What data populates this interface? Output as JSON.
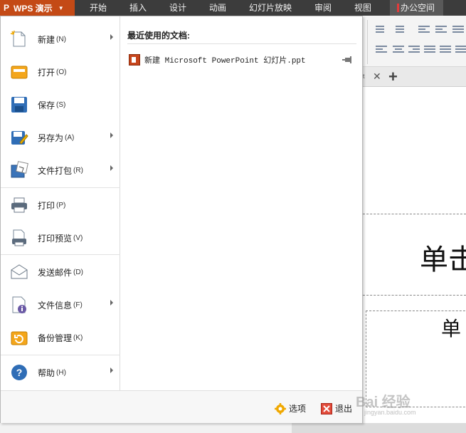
{
  "app": {
    "logo": "P",
    "title": "WPS 演示"
  },
  "menubar": {
    "tabs": [
      "开始",
      "插入",
      "设计",
      "动画",
      "幻灯片放映",
      "审阅",
      "视图"
    ],
    "office": "办公空间"
  },
  "file_menu": {
    "items": [
      {
        "label": "新建",
        "key": "(N)",
        "icon": "new-file-icon",
        "submenu": true
      },
      {
        "label": "打开",
        "key": "(O)",
        "icon": "open-folder-icon",
        "submenu": false
      },
      {
        "label": "保存",
        "key": "(S)",
        "icon": "save-disk-icon",
        "submenu": false
      },
      {
        "label": "另存为",
        "key": "(A)",
        "icon": "save-as-icon",
        "submenu": true
      },
      {
        "label": "文件打包",
        "key": "(R)",
        "icon": "package-icon",
        "submenu": true
      },
      {
        "label": "打印",
        "key": "(P)",
        "icon": "printer-icon",
        "submenu": false
      },
      {
        "label": "打印预览",
        "key": "(V)",
        "icon": "print-preview-icon",
        "submenu": false
      },
      {
        "label": "发送邮件",
        "key": "(D)",
        "icon": "mail-icon",
        "submenu": false
      },
      {
        "label": "文件信息",
        "key": "(F)",
        "icon": "file-info-icon",
        "submenu": true
      },
      {
        "label": "备份管理",
        "key": "(K)",
        "icon": "backup-icon",
        "submenu": false
      },
      {
        "label": "帮助",
        "key": "(H)",
        "icon": "help-icon",
        "submenu": true
      }
    ],
    "recent_title": "最近使用的文档:",
    "recent_files": [
      {
        "name": "新建 Microsoft PowerPoint 幻灯片.ppt",
        "icon": "ppt-file-icon",
        "pinned": false
      }
    ],
    "footer": {
      "options_label": "选项",
      "exit_label": "退出"
    }
  },
  "slide": {
    "title_fragment": "单击",
    "subtitle_fragment": "单"
  },
  "tabs": {
    "tab_fragment": "t",
    "add_label": "+"
  },
  "watermark": {
    "text": "Bai 经验",
    "url": "jingyan.baidu.com"
  },
  "colors": {
    "accent": "#c44a16",
    "menubar": "#3c3c3c",
    "office_marker": "#e23b3b"
  }
}
